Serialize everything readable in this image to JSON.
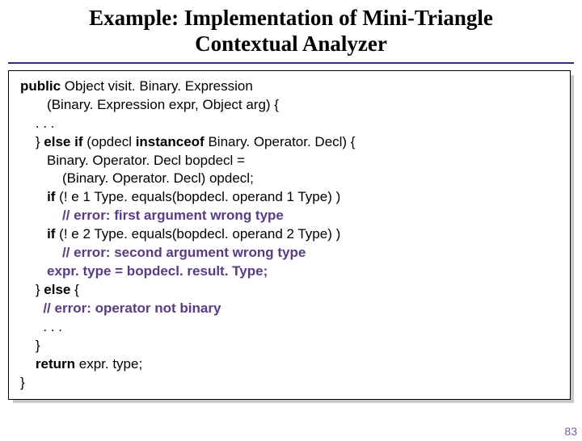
{
  "title_line1": "Example: Implementation of Mini-Triangle",
  "title_line2": "Contextual Analyzer",
  "code": {
    "l1a": "public ",
    "l1b": "Object visit. Binary. Expression",
    "l2": "       (Binary. Expression expr, Object arg) {",
    "l3": "    . . .",
    "l4a": "    } ",
    "l4b": "else if ",
    "l4c": "(opdecl ",
    "l4d": "instanceof ",
    "l4e": "Binary. Operator. Decl) {",
    "l5": "       Binary. Operator. Decl bopdecl =",
    "l6": "           (Binary. Operator. Decl) opdecl;",
    "l7a": "       ",
    "l7b": "if ",
    "l7c": "(! e 1 Type. equals(bopdecl. operand 1 Type) )",
    "l8": "           // error: first argument wrong type",
    "l9a": "       ",
    "l9b": "if ",
    "l9c": "(! e 2 Type. equals(bopdecl. operand 2 Type) )",
    "l10": "           // error: second argument wrong type",
    "l11": "       expr. type = bopdecl. result. Type;",
    "l12a": "    } ",
    "l12b": "else ",
    "l12c": "{",
    "l13": "      // error: operator not binary",
    "l14": "      . . .",
    "l15": "    }",
    "l16a": "    ",
    "l16b": "return ",
    "l16c": "expr. type;",
    "l17": "}"
  },
  "page_number": "83"
}
